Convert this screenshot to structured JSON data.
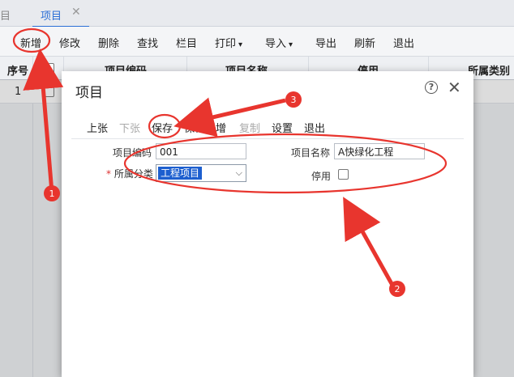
{
  "tabbar": {
    "stub": "目",
    "active_tab": "项目",
    "close": "✕"
  },
  "toolbar": {
    "items": [
      "新增",
      "修改",
      "删除",
      "查找",
      "栏目",
      "打印",
      "导入",
      "导出",
      "刷新",
      "退出"
    ],
    "print_caret": "▾",
    "import_caret": "▾"
  },
  "grid": {
    "headers": [
      "序号",
      "项目编码",
      "项目名称",
      "停用",
      "所属类别"
    ],
    "rows": [
      {
        "seq": "1"
      }
    ]
  },
  "dialog": {
    "title": "项目",
    "help": "?",
    "close": "✕",
    "toolbar": [
      {
        "label": "上张",
        "enabled": true
      },
      {
        "label": "下张",
        "enabled": false
      },
      {
        "label": "保存",
        "enabled": true
      },
      {
        "label": "保存新增",
        "enabled": true
      },
      {
        "label": "复制",
        "enabled": false
      },
      {
        "label": "设置",
        "enabled": true
      },
      {
        "label": "退出",
        "enabled": true
      }
    ],
    "form": {
      "code_label": "项目编码",
      "code_value": "001",
      "name_label": "项目名称",
      "name_value": "A快绿化工程",
      "required_mark": "*",
      "category_label": "所属分类",
      "category_value": "工程项目",
      "disabled_label": "停用"
    }
  },
  "annotations": {
    "markers": [
      "1",
      "2",
      "3"
    ],
    "color": "#e8352e"
  },
  "colors": {
    "accent": "#2b6fd6",
    "annotation": "#e8352e"
  }
}
